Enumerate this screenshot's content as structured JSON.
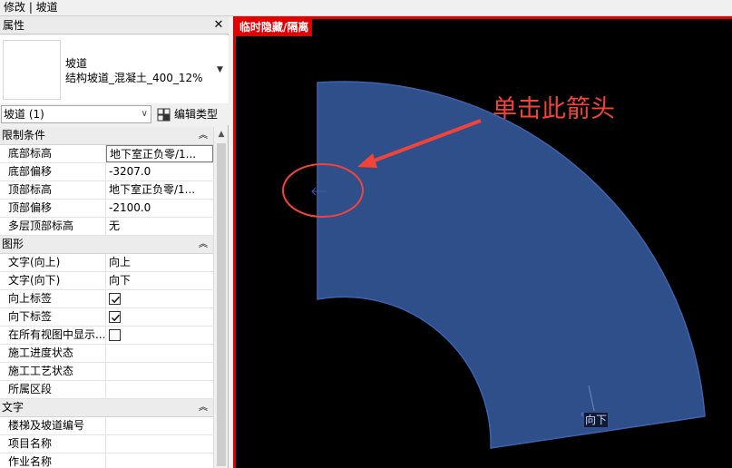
{
  "topbar": {
    "title": "修改 | 坡道"
  },
  "panel": {
    "title": "属性",
    "close_glyph": "✕",
    "type": {
      "name": "坡道",
      "sub": "结构坡道_混凝土_400_12%"
    },
    "instance": {
      "selected": "坡道 (1)"
    },
    "edit_type_label": "编辑类型",
    "groups": [
      {
        "label": "限制条件",
        "rows": [
          {
            "name": "底部标高",
            "value": "地下室正负零/1..."
          },
          {
            "name": "底部偏移",
            "value": "-3207.0"
          },
          {
            "name": "顶部标高",
            "value": "地下室正负零/1..."
          },
          {
            "name": "顶部偏移",
            "value": "-2100.0"
          },
          {
            "name": "多层顶部标高",
            "value": "无"
          }
        ]
      },
      {
        "label": "图形",
        "rows": [
          {
            "name": "文字(向上)",
            "value": "向上"
          },
          {
            "name": "文字(向下)",
            "value": "向下"
          },
          {
            "name": "向上标签",
            "checked": true
          },
          {
            "name": "向下标签",
            "checked": true
          },
          {
            "name": "在所有视图中显示...",
            "checked": false
          },
          {
            "name": "施工进度状态",
            "value": ""
          },
          {
            "name": "施工工艺状态",
            "value": ""
          },
          {
            "name": "所属区段",
            "value": ""
          }
        ]
      },
      {
        "label": "文字",
        "rows": [
          {
            "name": "楼梯及坡道编号",
            "value": ""
          },
          {
            "name": "项目名称",
            "value": ""
          },
          {
            "name": "作业名称",
            "value": ""
          }
        ]
      }
    ]
  },
  "viewport": {
    "isolation_label": "临时隐藏/隔离",
    "annotation": "单击此箭头",
    "down_label": "向下",
    "colors": {
      "ramp_fill": "#2e4f8a",
      "ramp_edge": "#3d63b0",
      "annotation": "#f0443a",
      "frame": "#e00000"
    }
  }
}
